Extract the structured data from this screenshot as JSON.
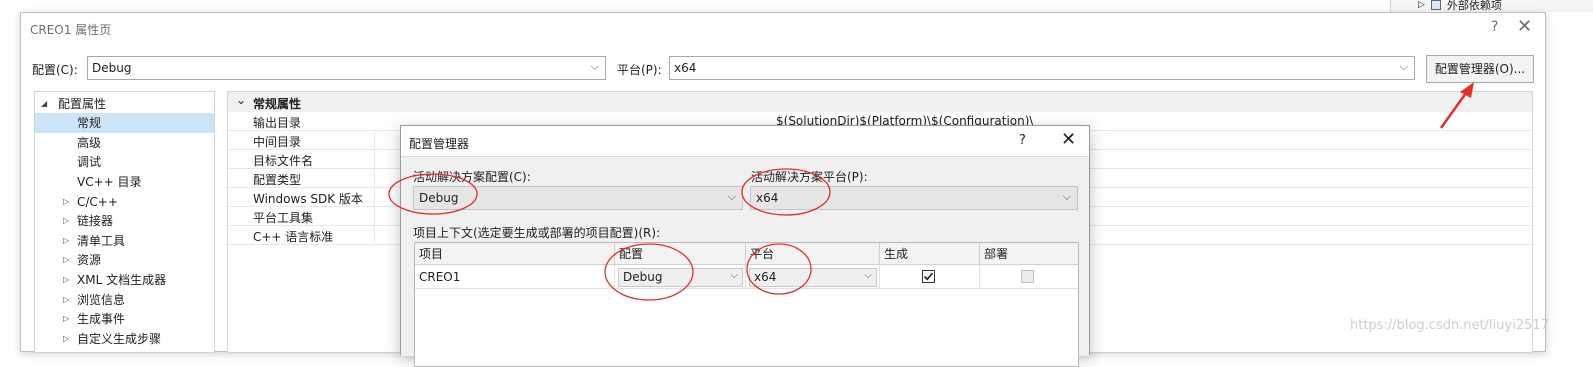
{
  "background": {
    "ext_deps_label": "外部依赖项"
  },
  "window": {
    "title": "CREO1 属性页",
    "help_glyph": "?",
    "close_glyph": "✕",
    "config_label": "配置(C):",
    "config_value": "Debug",
    "platform_label": "平台(P):",
    "platform_value": "x64",
    "config_manager_button": "配置管理器(O)..."
  },
  "tree": {
    "items": [
      {
        "label": "配置属性",
        "expander": "◢"
      },
      {
        "label": "常规",
        "expander": ""
      },
      {
        "label": "高级",
        "expander": ""
      },
      {
        "label": "调试",
        "expander": ""
      },
      {
        "label": "VC++ 目录",
        "expander": ""
      },
      {
        "label": "C/C++",
        "expander": "▷"
      },
      {
        "label": "链接器",
        "expander": "▷"
      },
      {
        "label": "清单工具",
        "expander": "▷"
      },
      {
        "label": "资源",
        "expander": "▷"
      },
      {
        "label": "XML 文档生成器",
        "expander": "▷"
      },
      {
        "label": "浏览信息",
        "expander": "▷"
      },
      {
        "label": "生成事件",
        "expander": "▷"
      },
      {
        "label": "自定义生成步骤",
        "expander": "▷"
      }
    ]
  },
  "grid": {
    "section_title": "常规属性",
    "section_expander": "⌄",
    "rows": [
      {
        "name": "输出目录",
        "value": "$(SolutionDir)$(Platform)\\$(Configuration)\\"
      },
      {
        "name": "中间目录",
        "value": ""
      },
      {
        "name": "目标文件名",
        "value": ""
      },
      {
        "name": "配置类型",
        "value": ""
      },
      {
        "name": "Windows SDK 版本",
        "value": ""
      },
      {
        "name": "平台工具集",
        "value": ""
      },
      {
        "name": "C++ 语言标准",
        "value": ""
      }
    ]
  },
  "config_manager": {
    "title": "配置管理器",
    "help_glyph": "?",
    "close_glyph": "✕",
    "active_config_label": "活动解决方案配置(C):",
    "active_config_value": "Debug",
    "active_platform_label": "活动解决方案平台(P):",
    "active_platform_value": "x64",
    "contexts_label": "项目上下文(选定要生成或部署的项目配置)(R):",
    "columns": [
      "项目",
      "配置",
      "平台",
      "生成",
      "部署"
    ],
    "project_rows": [
      {
        "project": "CREO1",
        "config": "Debug",
        "platform": "x64",
        "build": true,
        "deploy": false
      }
    ]
  },
  "watermark": "https://blog.csdn.net/liuyi2517",
  "colors": {
    "annotation_red": "#e0302a",
    "selection_blue": "#cce4f7"
  }
}
